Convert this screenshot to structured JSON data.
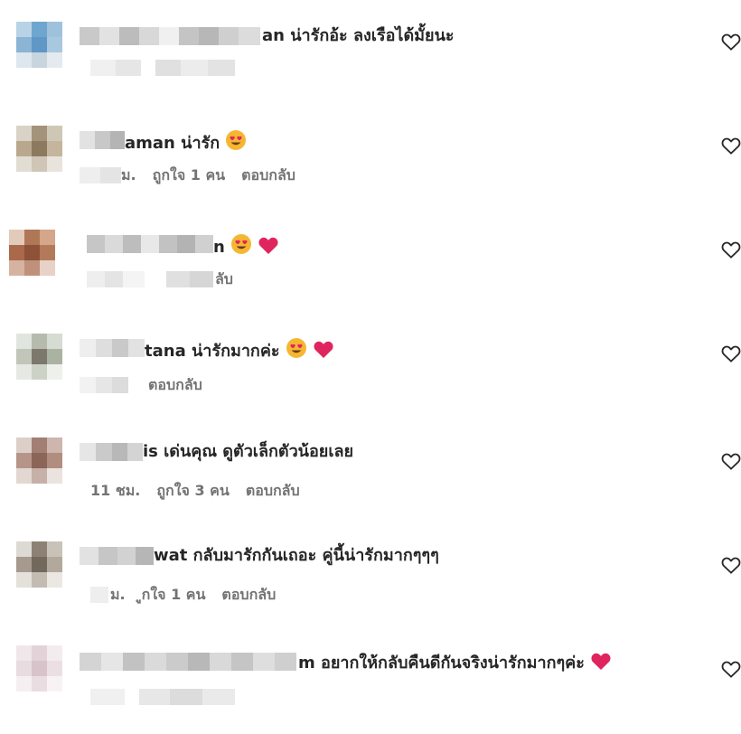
{
  "comments": [
    {
      "name_suffix": "an",
      "text": " น่ารักอ้ะ ลงเรือได้มั้ยนะ",
      "emojis": [],
      "meta": {
        "time": "",
        "likes": "",
        "reply": ""
      }
    },
    {
      "name_suffix": "aman",
      "text": " น่ารัก",
      "emojis": [
        "heart-eyes"
      ],
      "meta": {
        "time": "ม.",
        "likes": "ถูกใจ 1 คน",
        "reply": "ตอบกลับ"
      }
    },
    {
      "name_suffix": "n",
      "text": " ",
      "emojis": [
        "heart-eyes",
        "heart"
      ],
      "meta": {
        "time": "",
        "likes": "",
        "reply": "ลับ"
      }
    },
    {
      "name_suffix": "tana",
      "text": " น่ารักมากค่ะ",
      "emojis": [
        "heart-eyes",
        "heart"
      ],
      "meta": {
        "time": "",
        "likes": "",
        "reply": "ตอบกลับ"
      }
    },
    {
      "name_suffix": "is",
      "text": " เด่นคุณ ดูตัวเล็กตัวน้อยเลย",
      "emojis": [],
      "meta": {
        "time": "11 ชม.",
        "likes": "ถูกใจ 3 คน",
        "reply": "ตอบกลับ"
      }
    },
    {
      "name_suffix": "wat",
      "text": " กลับมารักกันเถอะ คู่นี้น่ารักมากๆๆๆ",
      "emojis": [],
      "meta": {
        "time": "ม.",
        "likes": "ูกใจ 1 คน",
        "reply": "ตอบกลับ"
      }
    },
    {
      "name_suffix": "m",
      "text": " อยากให้กลับคืนดีกันจริงน่ารักมากๆค่ะ",
      "emojis": [
        "heart"
      ],
      "meta": {
        "time": "",
        "likes": "",
        "reply": ""
      }
    }
  ],
  "icons": {
    "like": "heart-outline-icon",
    "heart_eyes": "heart-eyes-emoji",
    "heart": "heart-emoji"
  },
  "colors": {
    "text": "#262626",
    "meta": "#737373",
    "heart": "#e0245e",
    "emoji_face": "#f5b731"
  }
}
